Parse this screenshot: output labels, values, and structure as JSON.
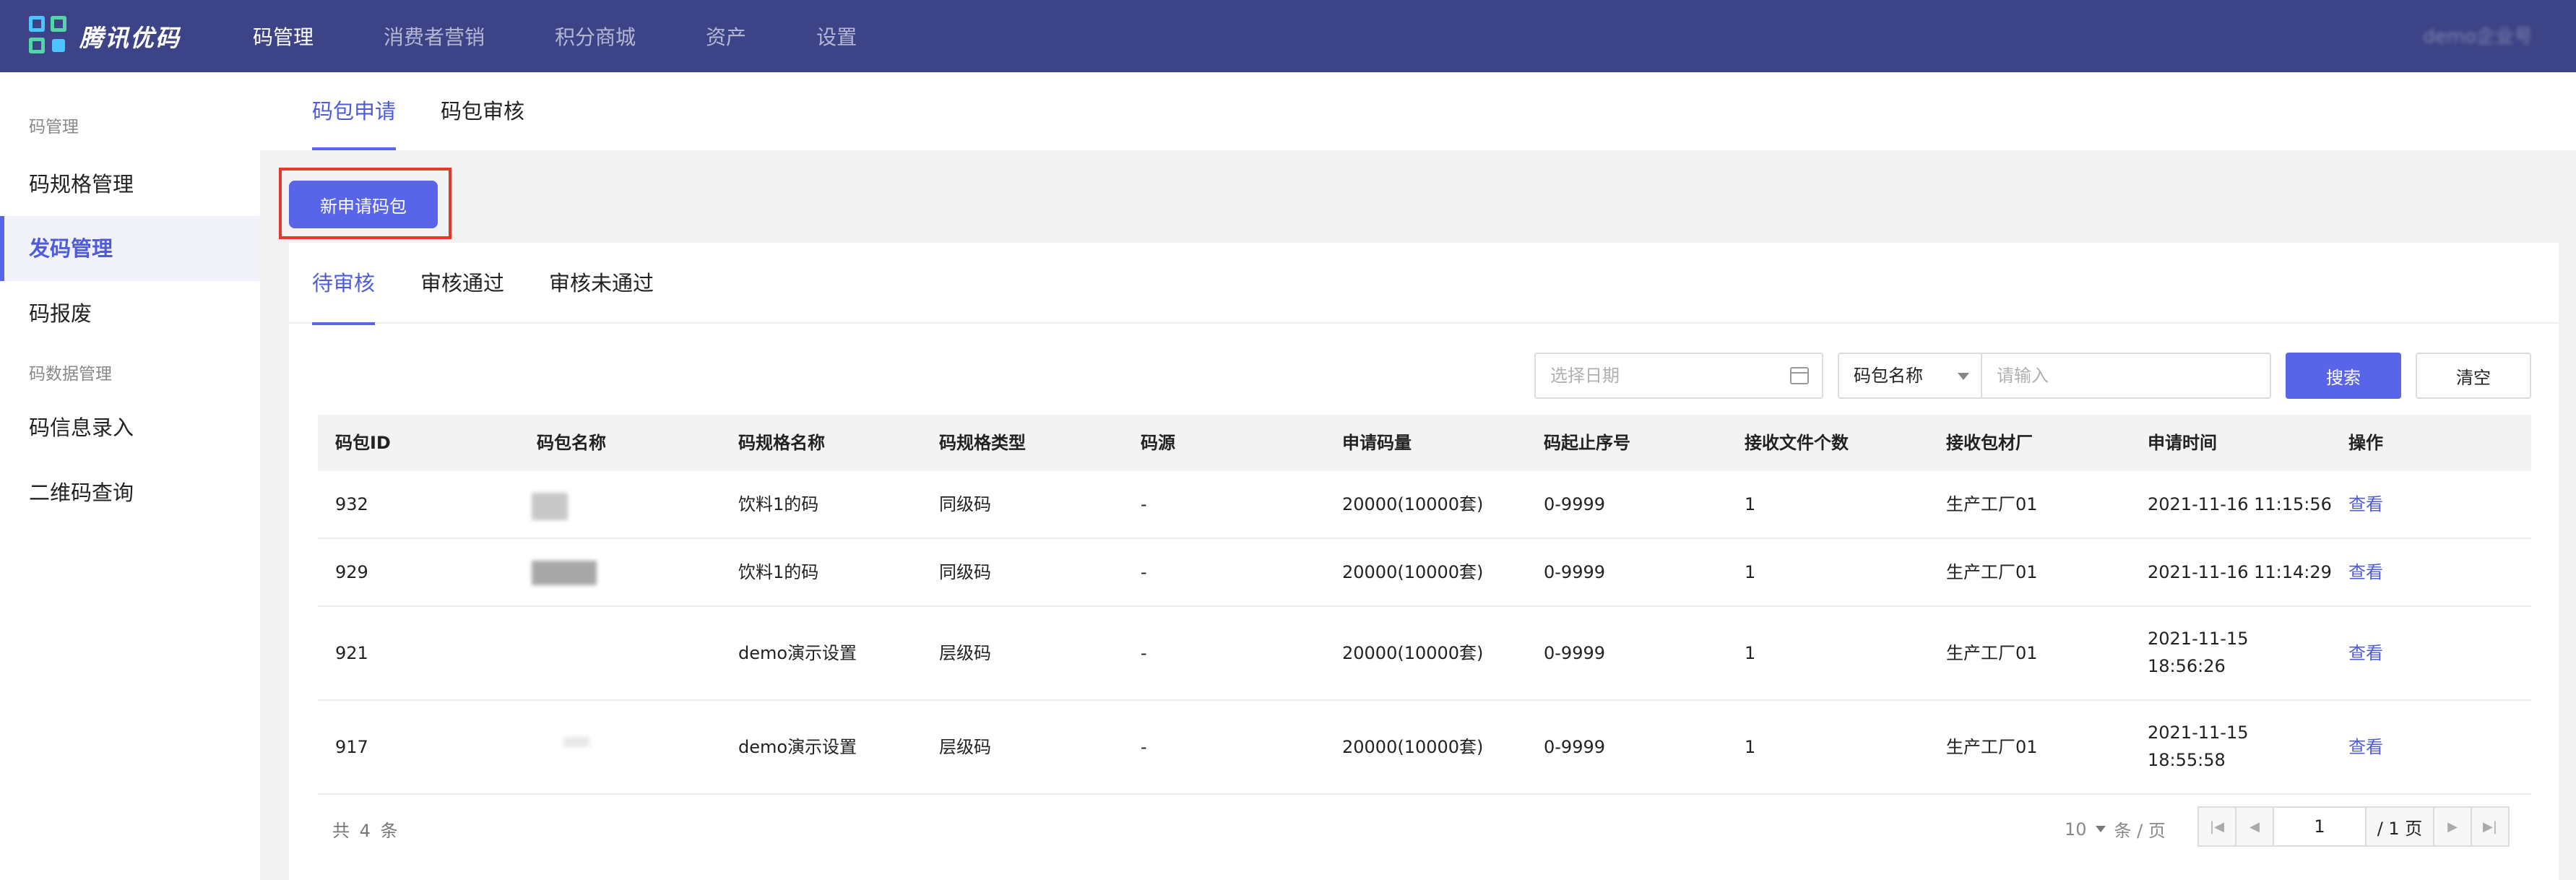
{
  "brand": {
    "name": "腾讯优码"
  },
  "topmenu": [
    "码管理",
    "消费者营销",
    "积分商城",
    "资产",
    "设置"
  ],
  "user": {
    "name": "demo企业号"
  },
  "sidebar": {
    "groups": [
      "码管理",
      "码数据管理"
    ],
    "items": [
      "码规格管理",
      "发码管理",
      "码报废",
      "码信息录入",
      "二维码查询"
    ]
  },
  "tabs": [
    "码包申请",
    "码包审核"
  ],
  "new_button": "新申请码包",
  "subtabs": [
    "待审核",
    "审核通过",
    "审核未通过"
  ],
  "filters": {
    "date_placeholder": "选择日期",
    "select_value": "码包名称",
    "input_placeholder": "请输入",
    "search_label": "搜索",
    "clear_label": "清空"
  },
  "table": {
    "headers": [
      "码包ID",
      "码包名称",
      "码规格名称",
      "码规格类型",
      "码源",
      "申请码量",
      "码起止序号",
      "接收文件个数",
      "接收包材厂",
      "申请时间",
      "操作"
    ],
    "rows": [
      {
        "id": "932",
        "spec": "饮料1的码",
        "type": "同级码",
        "source": "-",
        "qty": "20000(10000套)",
        "range": "0-9999",
        "files": "1",
        "factory": "生产工厂01",
        "time1": "2021-11-16 11:15:56",
        "time2": "",
        "action": "查看"
      },
      {
        "id": "929",
        "spec": "饮料1的码",
        "type": "同级码",
        "source": "-",
        "qty": "20000(10000套)",
        "range": "0-9999",
        "files": "1",
        "factory": "生产工厂01",
        "time1": "2021-11-16 11:14:29",
        "time2": "",
        "action": "查看"
      },
      {
        "id": "921",
        "spec": "demo演示设置",
        "type": "层级码",
        "source": "-",
        "qty": "20000(10000套)",
        "range": "0-9999",
        "files": "1",
        "factory": "生产工厂01",
        "time1": "2021-11-15",
        "time2": "18:56:26",
        "action": "查看"
      },
      {
        "id": "917",
        "spec": "demo演示设置",
        "type": "层级码",
        "source": "-",
        "qty": "20000(10000套)",
        "range": "0-9999",
        "files": "1",
        "factory": "生产工厂01",
        "time1": "2021-11-15",
        "time2": "18:55:58",
        "action": "查看"
      }
    ]
  },
  "pagination": {
    "total": "共 4 条",
    "page_size": "10",
    "page_size_unit": "条 / 页",
    "current_page": "1",
    "total_pages": "/ 1 页"
  }
}
